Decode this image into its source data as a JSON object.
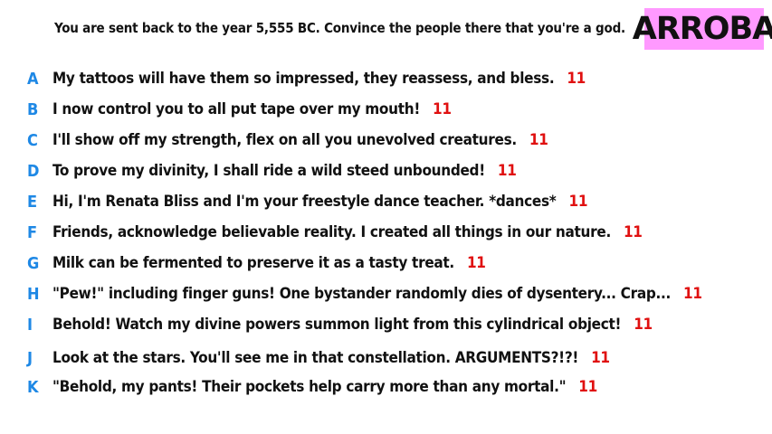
{
  "prompt": "You are sent back to the year 5,555 BC. Convince the people there that you're a god.",
  "logo": "ARROBA",
  "colors": {
    "letter": "#1e88e5",
    "score": "#e01010",
    "logo_bg": "#ff99ff"
  },
  "answers": [
    {
      "letter": "A",
      "text": "My tattoos will have them so impressed, they reassess, and bless.",
      "score": "11"
    },
    {
      "letter": "B",
      "text": "I now control you to all put tape over my mouth!",
      "score": "11"
    },
    {
      "letter": "C",
      "text": "I'll show off my strength, flex on all you unevolved creatures.",
      "score": "11"
    },
    {
      "letter": "D",
      "text": "To prove my divinity, I shall ride a wild steed unbounded!",
      "score": "11"
    },
    {
      "letter": "E",
      "text": "Hi, I'm Renata Bliss and I'm your freestyle dance teacher. *dances*",
      "score": "11"
    },
    {
      "letter": "F",
      "text": "Friends, acknowledge believable reality. I created all things in our nature.",
      "score": "11"
    },
    {
      "letter": "G",
      "text": "Milk can be fermented to preserve it as a tasty treat.",
      "score": "11"
    },
    {
      "letter": "H",
      "text": "\"Pew!\" including finger guns! One bystander randomly dies of dysentery... Crap...",
      "score": "11"
    },
    {
      "letter": "I",
      "text": "Behold! Watch my divine powers summon light from this cylindrical object!",
      "score": "11"
    },
    {
      "letter": "J",
      "text": "Look at the stars. You'll see me in that constellation. ARGUMENTS?!?!",
      "score": "11"
    },
    {
      "letter": "K",
      "text": "\"Behold, my pants! Their pockets help carry more than any mortal.\"",
      "score": "11"
    }
  ]
}
